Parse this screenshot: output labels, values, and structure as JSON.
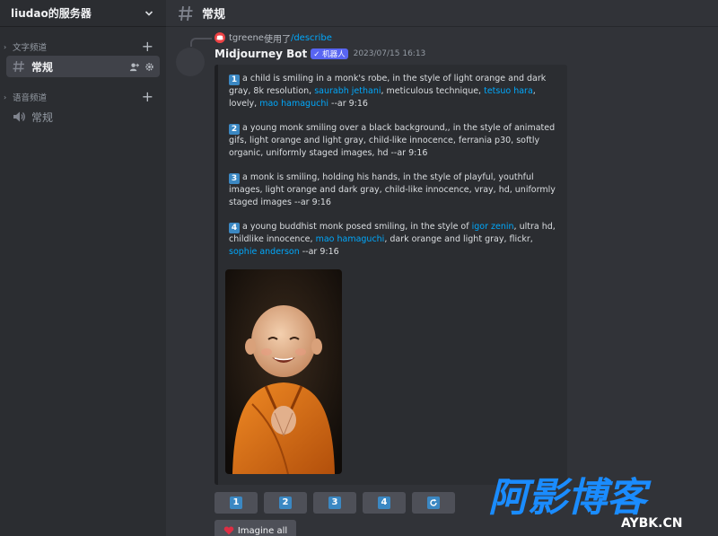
{
  "server": {
    "name": "liudao的服务器"
  },
  "sidebar": {
    "categories": [
      {
        "label": "文字频道",
        "channels": [
          {
            "name": "常规",
            "type": "text",
            "active": true
          }
        ]
      },
      {
        "label": "语音频道",
        "channels": [
          {
            "name": "常规",
            "type": "voice",
            "active": false
          }
        ]
      }
    ]
  },
  "topbar": {
    "channel_title": "常规"
  },
  "message": {
    "reply": {
      "user": "tgreene",
      "used_text": "使用了",
      "command": "/describe"
    },
    "author": "Midjourney Bot",
    "bot_badge": "✓ 机器人",
    "timestamp": "2023/07/15 16:13",
    "prompts": [
      {
        "number": "1",
        "segments": [
          {
            "text": "a child is smiling in a monk's robe, in the style of light orange and dark gray, 8k resolution, "
          },
          {
            "text": "saurabh jethani",
            "link": true
          },
          {
            "text": ", meticulous technique, "
          },
          {
            "text": "tetsuo hara",
            "link": true
          },
          {
            "text": ", lovely, "
          },
          {
            "text": "mao hamaguchi",
            "link": true
          },
          {
            "text": " --ar 9:16"
          }
        ]
      },
      {
        "number": "2",
        "segments": [
          {
            "text": "a young monk smiling over a black background,, in the style of animated gifs, light orange and light gray, child-like innocence, ferrania p30, softly organic, uniformly staged images, hd --ar 9:16"
          }
        ]
      },
      {
        "number": "3",
        "segments": [
          {
            "text": "a monk is smiling, holding his hands, in the style of playful, youthful images, light orange and dark gray, child-like innocence, vray, hd, uniformly staged images --ar 9:16"
          }
        ]
      },
      {
        "number": "4",
        "segments": [
          {
            "text": "a young buddhist monk posed smiling, in the style of "
          },
          {
            "text": "igor zenin",
            "link": true
          },
          {
            "text": ", ultra hd, childlike innocence, "
          },
          {
            "text": "mao hamaguchi",
            "link": true
          },
          {
            "text": ", dark orange and light gray, flickr, "
          },
          {
            "text": "sophie anderson",
            "link": true
          },
          {
            "text": " --ar 9:16"
          }
        ]
      }
    ]
  },
  "buttons": {
    "numbers": [
      "1",
      "2",
      "3",
      "4"
    ],
    "refresh_icon": "refresh-icon",
    "imagine_all": "Imagine all"
  },
  "watermark": {
    "title": "阿影博客",
    "subtitle": "AYBK.CN"
  },
  "colors": {
    "link": "#00a8fc",
    "badge": "#5865f2",
    "keycap": "#3b88c3",
    "watermark": "#1a8cff"
  }
}
